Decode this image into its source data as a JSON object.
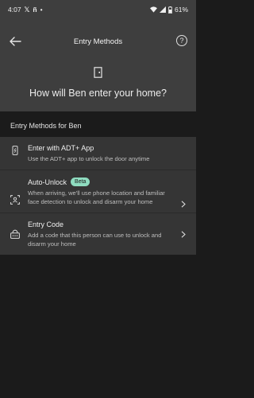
{
  "status_bar": {
    "time": "4:07",
    "battery": "61%"
  },
  "header": {
    "title": "Entry Methods",
    "help_label": "?"
  },
  "question": "How will Ben enter your home?",
  "section_header": "Entry Methods for Ben",
  "items": [
    {
      "title": "Enter with ADT+ App",
      "description": "Use the ADT+ app to unlock the door anytime",
      "icon": "phone-icon"
    },
    {
      "title": "Auto-Unlock",
      "badge": "Beta",
      "description": "When arriving, we'll use phone location and familiar face detection to unlock and disarm your home",
      "icon": "face-scan-icon"
    },
    {
      "title": "Entry Code",
      "description": "Add a code that this person can use to unlock and disarm your home",
      "icon": "lock-keypad-icon"
    }
  ],
  "colors": {
    "top_background": "#3e3e3e",
    "page_background": "#1b1b1b",
    "list_background": "#353535",
    "badge_background": "#8fdcc0"
  }
}
